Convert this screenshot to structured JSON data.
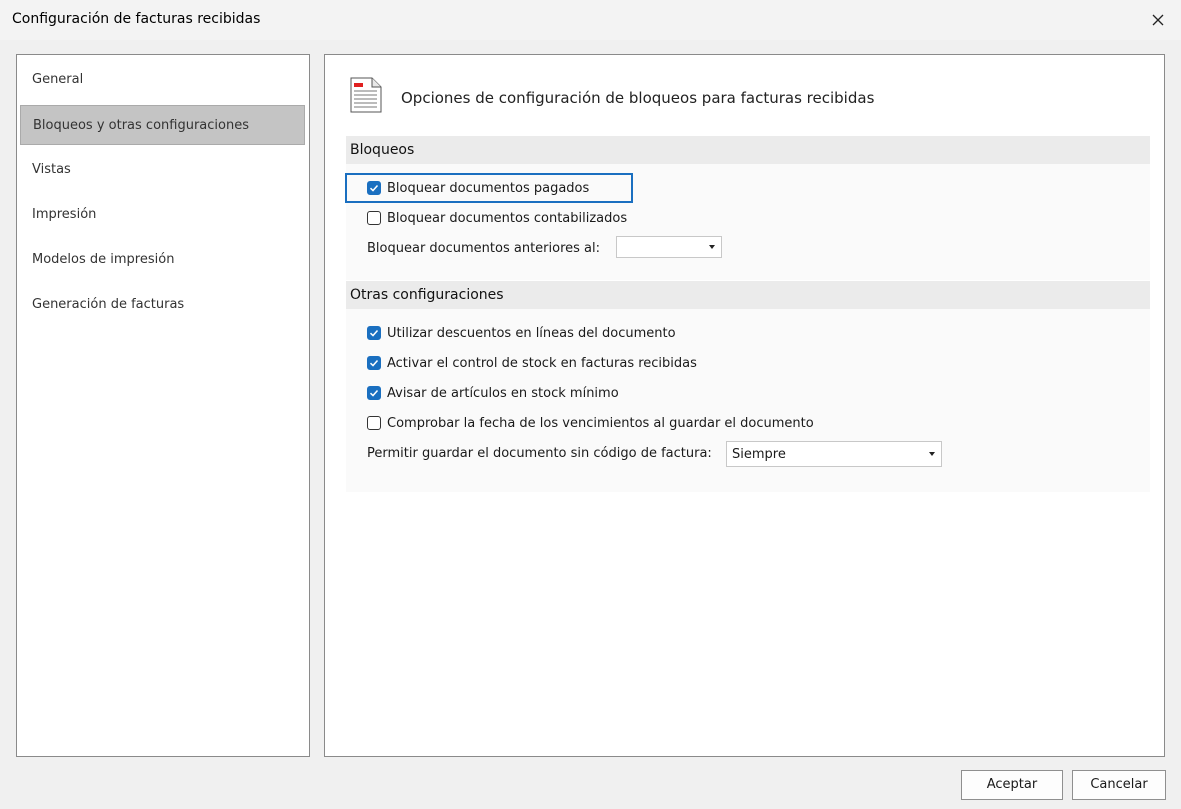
{
  "window": {
    "title": "Configuración de facturas recibidas"
  },
  "sidebar": {
    "items": [
      {
        "label": "General"
      },
      {
        "label": "Bloqueos y otras configuraciones"
      },
      {
        "label": "Vistas"
      },
      {
        "label": "Impresión"
      },
      {
        "label": "Modelos de impresión"
      },
      {
        "label": "Generación de facturas"
      }
    ],
    "selected": "Bloqueos y otras configuraciones"
  },
  "main": {
    "heading": "Opciones de configuración de bloqueos para facturas recibidas",
    "bloqueos": {
      "header": "Bloqueos",
      "bloquear_pagados": {
        "label": "Bloquear documentos pagados",
        "checked": true
      },
      "bloquear_contabilizados": {
        "label": "Bloquear documentos contabilizados",
        "checked": false
      },
      "anteriores_label": "Bloquear documentos anteriores al:",
      "anteriores_value": ""
    },
    "otras": {
      "header": "Otras configuraciones",
      "descuentos": {
        "label": "Utilizar descuentos en líneas del documento",
        "checked": true
      },
      "control_stock": {
        "label": "Activar el control de stock en facturas recibidas",
        "checked": true
      },
      "stock_minimo": {
        "label": "Avisar de artículos en stock mínimo",
        "checked": true
      },
      "vencimientos": {
        "label": "Comprobar la fecha de los vencimientos al guardar el documento",
        "checked": false
      },
      "sin_codigo_label": "Permitir guardar el documento sin código de factura:",
      "sin_codigo_value": "Siempre"
    }
  },
  "footer": {
    "accept_label": "Aceptar",
    "cancel_label": "Cancelar"
  },
  "colors": {
    "accent": "#1a6fc0",
    "selected_nav": "#c4c4c4",
    "section_header": "#ebebeb"
  }
}
